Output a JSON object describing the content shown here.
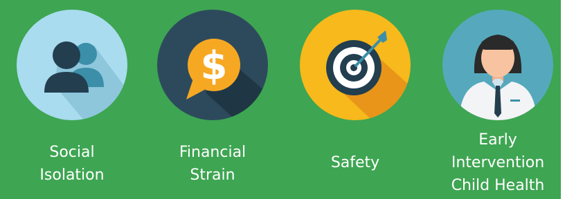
{
  "colors": {
    "background": "#3ea552",
    "social_circle": "#a9dcef",
    "financial_circle": "#2d4a5c",
    "safety_circle": "#f7b91b",
    "health_circle": "#56a9bc",
    "text": "#ffffff"
  },
  "items": [
    {
      "icon": "people-icon",
      "caption_lines": [
        "Social",
        "Isolation"
      ]
    },
    {
      "icon": "dollar-speech-bubble-icon",
      "caption_lines": [
        "Financial",
        "Strain"
      ]
    },
    {
      "icon": "target-arrow-icon",
      "caption_lines": [
        "Safety"
      ]
    },
    {
      "icon": "doctor-icon",
      "caption_lines": [
        "Early",
        "Intervention",
        "Child Health"
      ]
    }
  ]
}
